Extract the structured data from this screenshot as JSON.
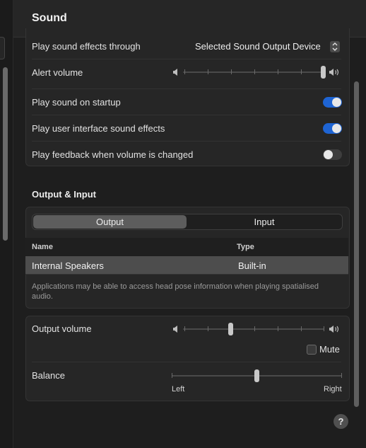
{
  "header": {
    "title": "Sound"
  },
  "effects": {
    "output_label": "Play sound effects through",
    "output_value": "Selected Sound Output Device",
    "alert_volume_label": "Alert volume",
    "alert_volume_level": 1.0,
    "startup_label": "Play sound on startup",
    "startup_on": true,
    "ui_sounds_label": "Play user interface sound effects",
    "ui_sounds_on": true,
    "feedback_label": "Play feedback when volume is changed",
    "feedback_on": false
  },
  "output_input": {
    "section_title": "Output & Input",
    "tabs": [
      "Output",
      "Input"
    ],
    "selected_tab": "Output",
    "columns": [
      "Name",
      "Type"
    ],
    "rows": [
      {
        "name": "Internal Speakers",
        "type": "Built-in",
        "selected": true
      }
    ],
    "note": "Applications may be able to access head pose information when playing spatialised audio."
  },
  "volume": {
    "output_label": "Output volume",
    "output_level": 0.33,
    "mute_label": "Mute",
    "muted": false,
    "balance_label": "Balance",
    "balance_value": 0.5,
    "balance_left": "Left",
    "balance_right": "Right"
  },
  "help": {
    "label": "?"
  },
  "colors": {
    "accent": "#1e64d3",
    "background": "#1e1e1e",
    "panel": "#262626"
  },
  "icons": {
    "speaker_low": "speaker-low-icon",
    "speaker_high": "speaker-high-icon",
    "stepper": "up-down-chevron-icon"
  }
}
